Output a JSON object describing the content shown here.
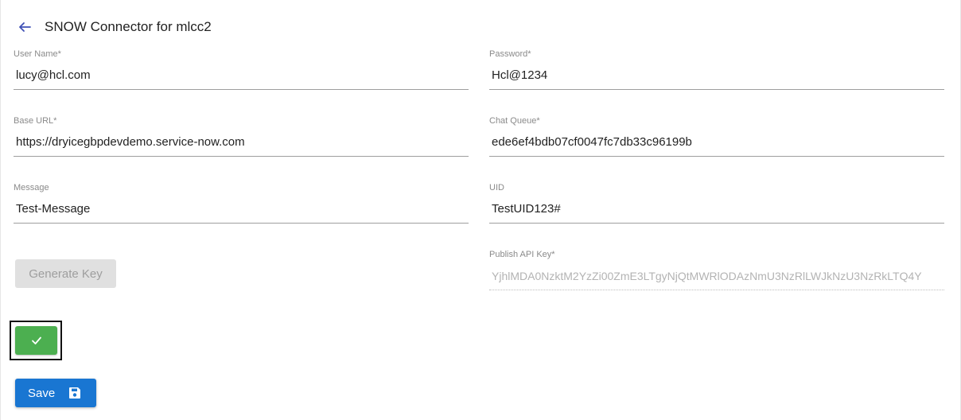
{
  "header": {
    "title": "SNOW Connector for mlcc2",
    "back_icon": "arrow-left-icon"
  },
  "form": {
    "user_name": {
      "label": "User Name*",
      "value": "lucy@hcl.com"
    },
    "password": {
      "label": "Password*",
      "value": "Hcl@1234"
    },
    "base_url": {
      "label": "Base URL*",
      "value": "https://dryicegbpdevdemo.service-now.com"
    },
    "chat_queue": {
      "label": "Chat Queue*",
      "value": "ede6ef4bdb07cf0047fc7db33c96199b"
    },
    "message": {
      "label": "Message",
      "value": "Test-Message"
    },
    "uid": {
      "label": "UID",
      "value": "TestUID123#"
    },
    "publish_api_key": {
      "label": "Publish API Key*",
      "value": "YjhlMDA0NzktM2YzZi00ZmE3LTgyNjQtMWRlODAzNmU3NzRlLWJkNzU3NzRkLTQ4Y"
    }
  },
  "buttons": {
    "generate_key": "Generate Key",
    "confirm_icon": "checkmark-icon",
    "save": "Save",
    "save_icon": "floppy-disk-icon"
  },
  "colors": {
    "accent": "#1976d2",
    "success": "#4caf50",
    "disabled_bg": "#e0e0e0"
  }
}
